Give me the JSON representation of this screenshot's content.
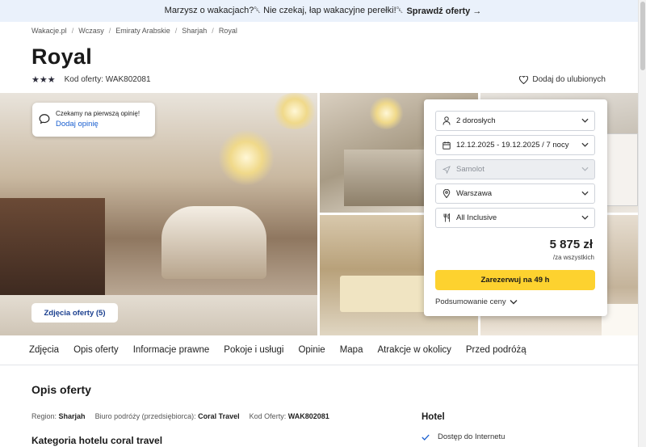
{
  "banner": {
    "text": "Marzysz o wakacjach?␡ Nie czekaj, łap wakacyjne perełki!␡",
    "cta": "Sprawdź oferty →"
  },
  "breadcrumb": [
    "Wakacje.pl",
    "Wczasy",
    "Emiraty Arabskie",
    "Sharjah",
    "Royal"
  ],
  "hotel": {
    "name": "Royal",
    "stars": 3,
    "offer_code": "Kod oferty: WAK802081",
    "favorite_label": "Dodaj do ulubionych"
  },
  "review_card": {
    "text": "Czekamy na pierwszą opinię!",
    "link": "Dodaj opinię"
  },
  "gallery": {
    "photos_button": "Zdjęcia oferty (5)"
  },
  "booking": {
    "travelers": "2 dorosłych",
    "dates": "12.12.2025 - 19.12.2025 / 7 nocy",
    "transport": "Samolot",
    "departure": "Warszawa",
    "board": "All Inclusive",
    "price": "5 875 zł",
    "price_note": "/za wszystkich",
    "book_button": "Zarezerwuj na 49 h",
    "summary": "Podsumowanie ceny"
  },
  "tabs": [
    "Zdjęcia",
    "Opis oferty",
    "Informacje prawne",
    "Pokoje i usługi",
    "Opinie",
    "Mapa",
    "Atrakcje w okolicy",
    "Przed podróżą"
  ],
  "description": {
    "title": "Opis oferty",
    "region_label": "Region:",
    "region": "Sharjah",
    "operator_label": "Biuro podróży (przedsiębiorca):",
    "operator": "Coral Travel",
    "code_label": "Kod Oferty:",
    "code": "WAK802081",
    "category_title": "Kategoria hotelu coral travel"
  },
  "hotel_section": {
    "title": "Hotel",
    "amenity": "Dostęp do Internetu"
  },
  "colors": {
    "accent_yellow": "#fdd22f",
    "link_blue": "#1a5fd0",
    "banner_bg": "#eaf1fb"
  }
}
